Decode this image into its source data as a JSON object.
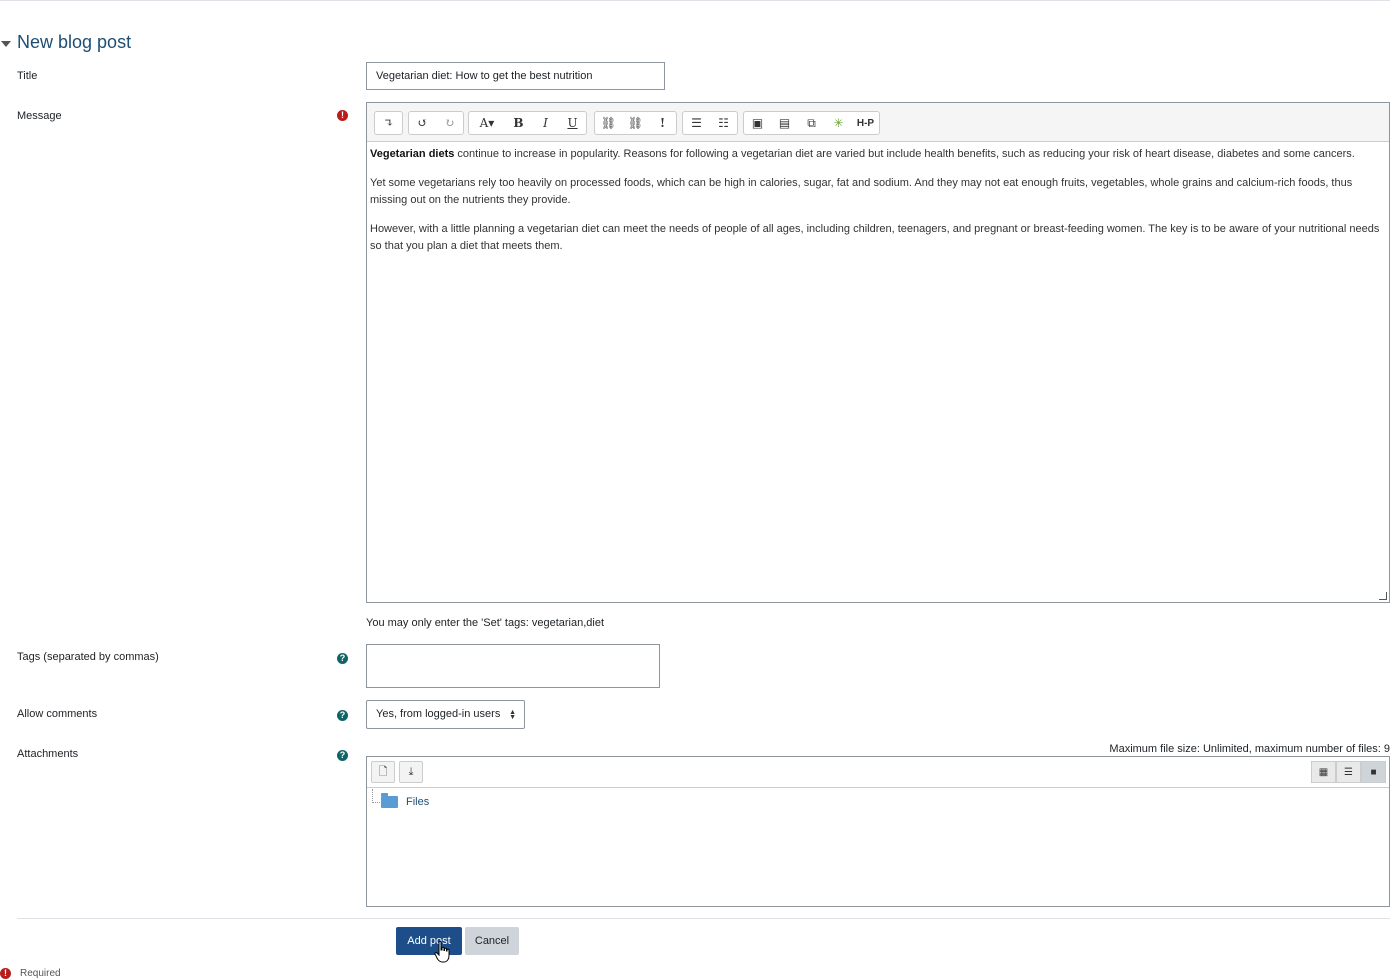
{
  "section": {
    "title": "New blog post"
  },
  "fields": {
    "title_label": "Title",
    "title_value": "Vegetarian diet: How to get the best nutrition",
    "message_label": "Message",
    "tags_label": "Tags (separated by commas)",
    "tags_note": "You may only enter the 'Set' tags: vegetarian,diet",
    "tags_value": "",
    "comments_label": "Allow comments",
    "comments_value": "Yes, from logged-in users",
    "attachments_label": "Attachments",
    "attachments_limit": "Maximum file size: Unlimited, maximum number of files: 9"
  },
  "editor": {
    "paragraphs": [
      {
        "bold": "Vegetarian diets",
        "text": " continue to increase in popularity. Reasons for following a vegetarian diet are varied but include health benefits, such as reducing your risk of heart disease, diabetes and some cancers."
      },
      {
        "bold": "",
        "text": "Yet some vegetarians rely too heavily on processed foods, which can be high in calories, sugar, fat and sodium. And they may not eat enough fruits, vegetables, whole grains and calcium-rich foods, thus missing out on the nutrients they provide."
      },
      {
        "bold": "",
        "text": "However, with a little planning a vegetarian diet can meet the needs of people of all ages, including children, teenagers, and pregnant or breast-feeding women. The key is to be aware of your nutritional needs so that you plan a diet that meets them."
      }
    ],
    "toolbar_icons": [
      "collapse-icon",
      "undo-icon",
      "redo-icon",
      "font-style-icon",
      "bold-icon",
      "italic-icon",
      "underline-icon",
      "link-icon",
      "unlink-icon",
      "emoji-icon",
      "unordered-list-icon",
      "ordered-list-icon",
      "image-icon",
      "media-icon",
      "manage-files-icon",
      "accessibility-icon",
      "h5p-icon"
    ],
    "h5p_label": "H-P"
  },
  "files": {
    "folder_label": "Files"
  },
  "buttons": {
    "submit": "Add post",
    "cancel": "Cancel"
  },
  "footer": {
    "required": "Required"
  },
  "colors": {
    "primary": "#1d4e89",
    "heading": "#1d4e74",
    "help": "#116466",
    "required": "#b81c1c"
  }
}
